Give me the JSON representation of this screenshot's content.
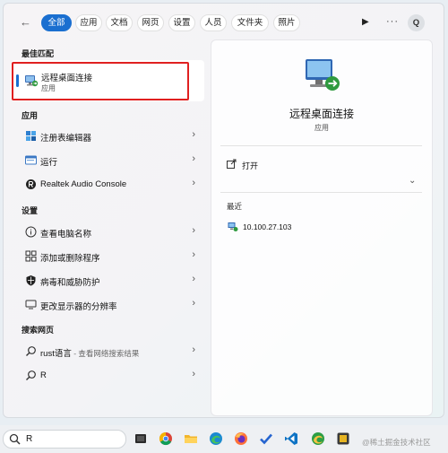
{
  "filter_tabs": [
    "全部",
    "应用",
    "文档",
    "网页",
    "设置",
    "人员",
    "文件夹",
    "照片"
  ],
  "profile_initial": "Q",
  "sections": {
    "best_match": "最佳匹配",
    "apps": "应用",
    "settings": "设置",
    "web": "搜索网页"
  },
  "best_match": {
    "title": "远程桌面连接",
    "subtitle": "应用"
  },
  "apps": [
    {
      "label": "注册表编辑器",
      "icon": "registry-icon"
    },
    {
      "label": "运行",
      "icon": "run-icon"
    },
    {
      "label": "Realtek Audio Console",
      "icon": "realtek-icon"
    }
  ],
  "settings": [
    {
      "label": "查看电脑名称",
      "icon": "info-icon"
    },
    {
      "label": "添加或删除程序",
      "icon": "apps-icon"
    },
    {
      "label": "病毒和威胁防护",
      "icon": "shield-icon"
    },
    {
      "label": "更改显示器的分辨率",
      "icon": "display-icon"
    }
  ],
  "web": [
    {
      "label": "rust语言",
      "sub": " - 查看网络搜索结果",
      "icon": "search-icon"
    },
    {
      "label": "R",
      "sub": "",
      "icon": "search-icon"
    }
  ],
  "detail": {
    "title": "远程桌面连接",
    "subtitle": "应用",
    "open_label": "打开",
    "recent_heading": "最近",
    "recent_items": [
      "10.100.27.103"
    ]
  },
  "taskbar": {
    "search_value": "R",
    "watermark": "@稀土掘金技术社区"
  },
  "colors": {
    "accent": "#1a6fd0",
    "highlight_outline": "#e02020"
  }
}
